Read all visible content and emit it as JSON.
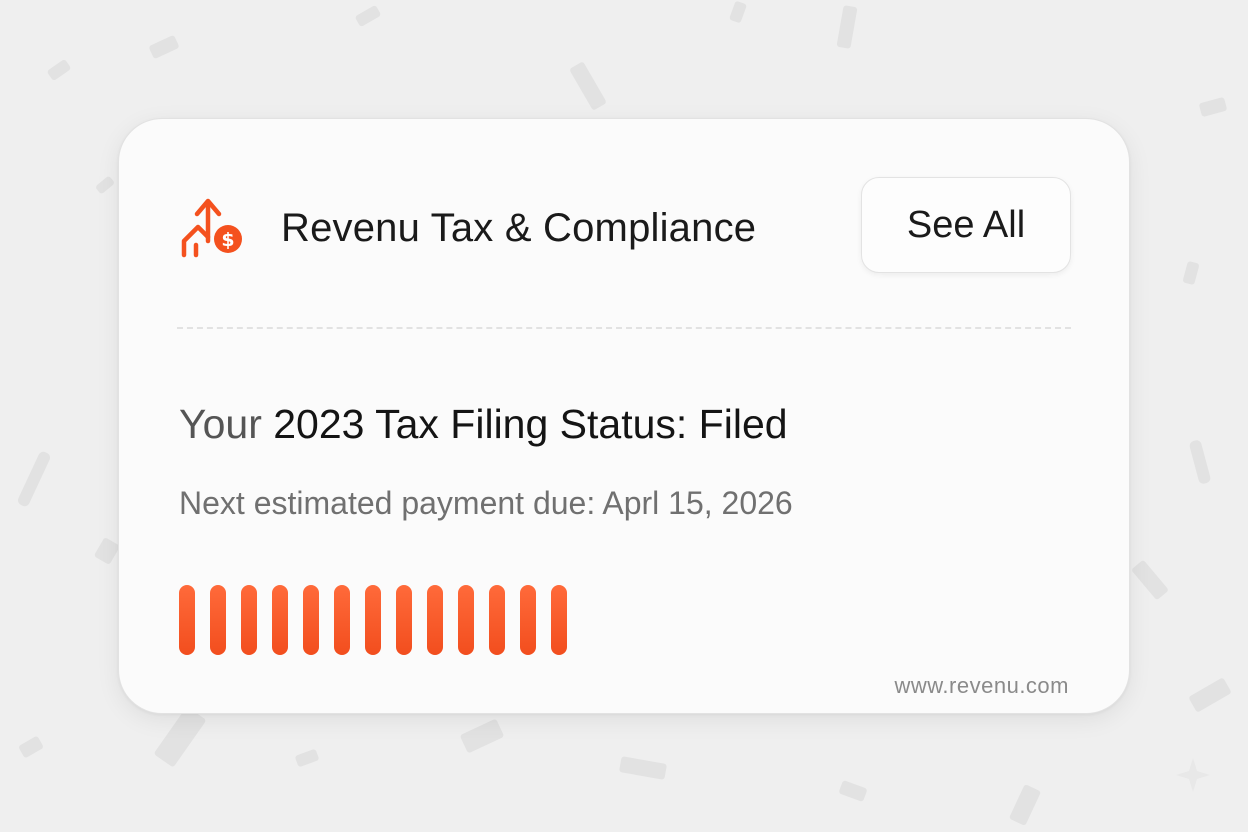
{
  "colors": {
    "accent": "#F4511E",
    "background": "#EFEFEF",
    "card": "#FBFBFB",
    "text_primary": "#141414",
    "text_muted": "#707070"
  },
  "header": {
    "icon": "house-money-growth-icon",
    "title": "Revenu Tax & Compliance",
    "see_all_label": "See All"
  },
  "status": {
    "prefix": "Your",
    "main": "2023 Tax Filing Status: Filed"
  },
  "next_payment": {
    "text": "Next estimated payment due: Aprl 15, 2026"
  },
  "progress": {
    "segment_count": 13
  },
  "footer": {
    "website": "www.revenu.com"
  }
}
